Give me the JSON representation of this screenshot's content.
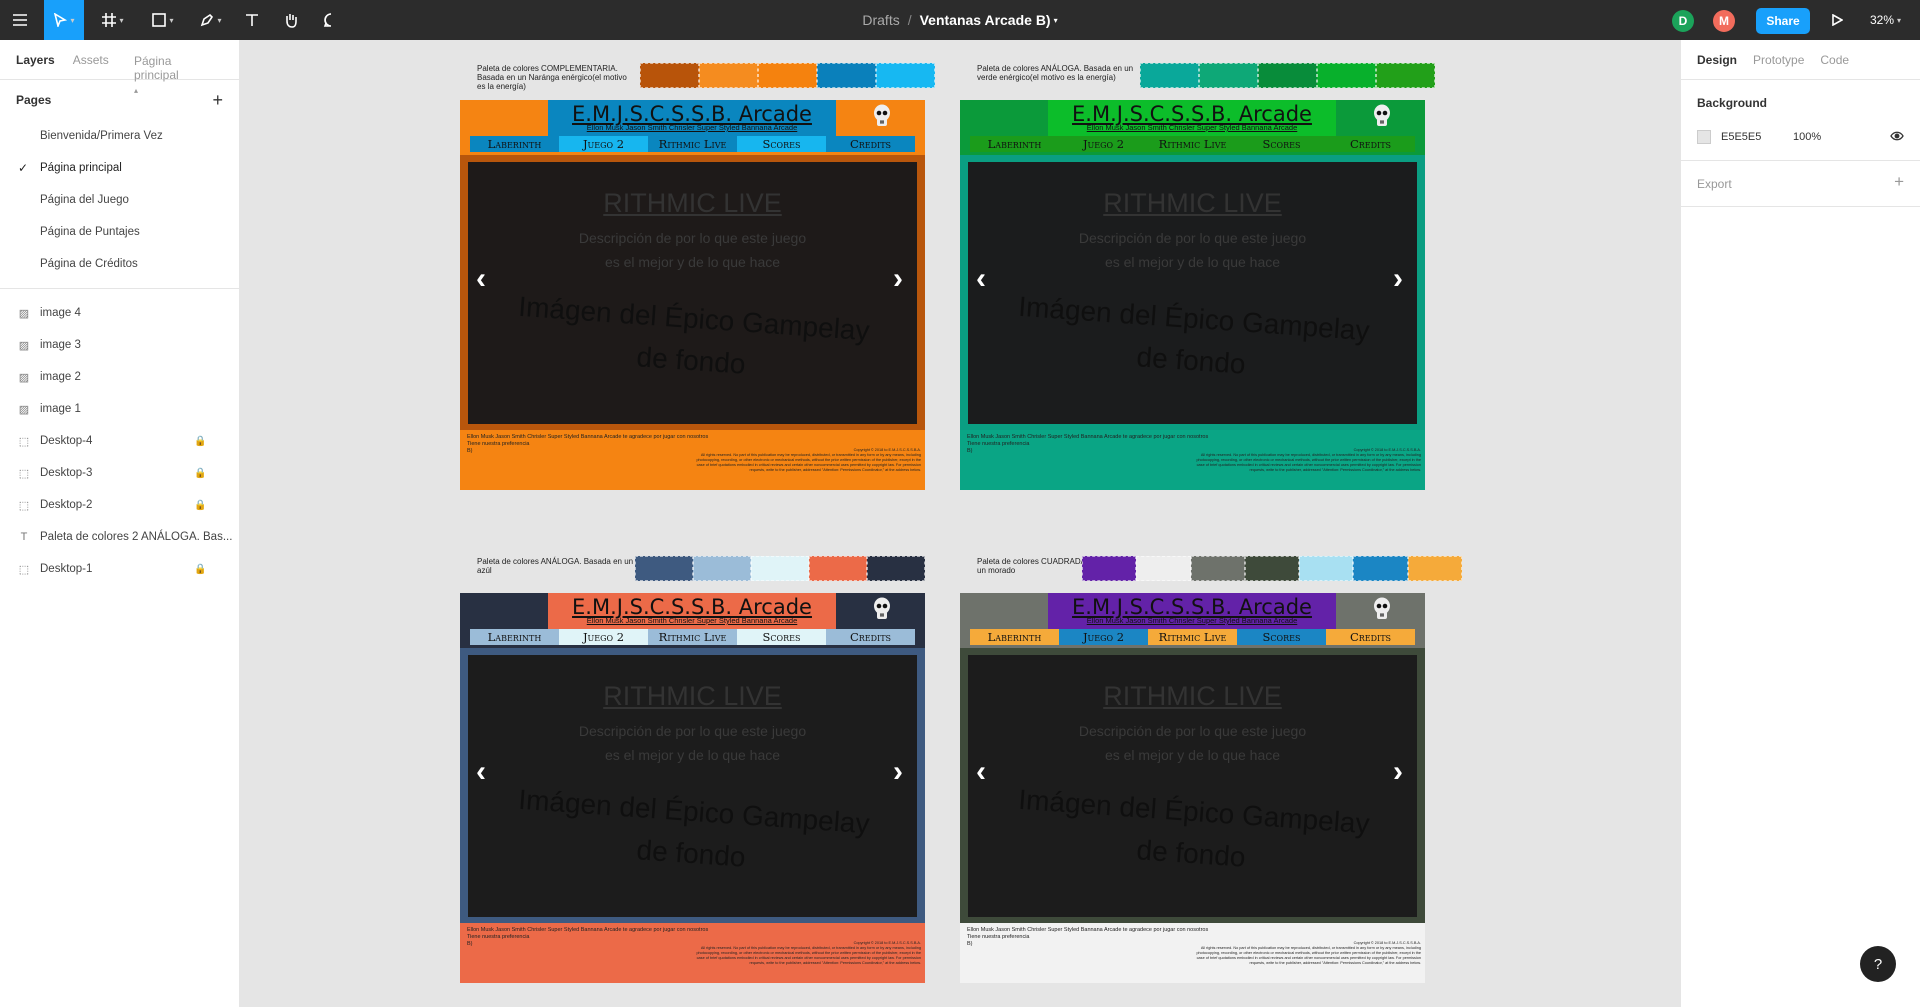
{
  "topbar": {
    "crumb": "Drafts",
    "sep": "/",
    "file_title": "Ventanas Arcade B)",
    "share_label": "Share",
    "zoom": "32%",
    "users": [
      {
        "initial": "D",
        "color": "#1ba35a"
      },
      {
        "initial": "M",
        "color": "#f26c5c"
      }
    ]
  },
  "left": {
    "tabs": [
      "Layers",
      "Assets"
    ],
    "page_selector": "Página principal",
    "pages_header": "Pages",
    "pages": [
      {
        "label": "Bienvenida/Primera Vez",
        "selected": false
      },
      {
        "label": "Página principal",
        "selected": true
      },
      {
        "label": "Página del Juego",
        "selected": false
      },
      {
        "label": "Página de Puntajes",
        "selected": false
      },
      {
        "label": "Página de Créditos",
        "selected": false
      }
    ],
    "layers": [
      {
        "label": "image 4",
        "icon": "image-icon",
        "locked": false
      },
      {
        "label": "image 3",
        "icon": "image-icon",
        "locked": false
      },
      {
        "label": "image 2",
        "icon": "image-icon",
        "locked": false
      },
      {
        "label": "image 1",
        "icon": "image-icon",
        "locked": false
      },
      {
        "label": "Desktop-4",
        "icon": "frame-icon",
        "locked": true
      },
      {
        "label": "Desktop-3",
        "icon": "frame-icon",
        "locked": true
      },
      {
        "label": "Desktop-2",
        "icon": "frame-icon",
        "locked": true
      },
      {
        "label": "Paleta de colores 2 ANÁLOGA. Bas...",
        "icon": "text-icon",
        "locked": false
      },
      {
        "label": "Desktop-1",
        "icon": "frame-icon",
        "locked": true
      }
    ]
  },
  "right": {
    "tabs": [
      "Design",
      "Prototype",
      "Code"
    ],
    "background_label": "Background",
    "bg_hex": "E5E5E5",
    "bg_opacity": "100%",
    "export_label": "Export"
  },
  "frame_text": {
    "title": "E.M.J.S.C.S.S.B. Arcade",
    "subtitle": "Ellon Musk Jason Smith Chrisler Super Styled Bannana Arcade",
    "nav": [
      "Laberinth",
      "Juego 2",
      "Rithmic Live",
      "Scores",
      "Credits"
    ],
    "game_title": "RITHMIC LIVE",
    "game_desc": "Descripción de por lo que este juego es el mejor y de lo que hace",
    "game_image": "Imágen del Épico Gampelay de fondo",
    "footer_thanks": "Ellon Musk Jason Smith Chrisler Super Styled Bannana Arcade te agradece por jugar con nosotros",
    "footer_pref": "Tiene nuestra preferencia",
    "footer_sign": "B)",
    "copyright": "Copyright © 2018 to E.M.J.S.C.S.S.B.A.",
    "legal": "All rights reserved. No part of this publication may be reproduced, distributed, or transmitted in any form or by any means, including photocopying, recording, or other electronic or mechanical methods, without the prior written permission of the publisher, except in the case of brief quotations embodied in critical reviews and certain other noncommercial uses permitted by copyright law. For permission requests, write to the publisher, addressed \"Attention: Permissions Coordinator,\" at the address below."
  },
  "frames": [
    {
      "palette_label": "Paleta de colores COMPLEMENTARIA. Basada en un Naránga enérgico(el motivo es la energía)",
      "swatches": [
        "#b8540a",
        "#f58c1f",
        "#f5820e",
        "#0a80bb",
        "#17b8f2"
      ],
      "header_bg": "#f58412",
      "title_bg": "#0a86bf",
      "frame_border": "#b8560c",
      "footer_bg": "#f58412",
      "nav_bg": [
        "#0a86bf",
        "#17b6ef",
        "#0a86bf",
        "#17b6ef",
        "#0a86bf"
      ],
      "body_bg": "#1e1a19"
    },
    {
      "palette_label": "Paleta de colores ANÁLOGA. Basada en un verde enérgico(el motivo es la energía)",
      "swatches": [
        "#0aa89a",
        "#0ea877",
        "#088c3a",
        "#08b02c",
        "#22a019"
      ],
      "header_bg": "#0b9a3a",
      "title_bg": "#0cbd2a",
      "frame_border": "#0a9e82",
      "footer_bg": "#0aa585",
      "nav_bg": [
        "#1b9c1b",
        "#1b9c1b",
        "#1b9c1b",
        "#1b9c1b",
        "#1b9c1b"
      ],
      "body_bg": "#1b1c1d"
    },
    {
      "palette_label": "Paleta de colores ANÁLOGA. Basada en un azúl",
      "swatches": [
        "#3e5a80",
        "#9bbcd8",
        "#e0f4f8",
        "#ec6a48",
        "#283042"
      ],
      "header_bg": "#283042",
      "title_bg": "#ec6a48",
      "frame_border": "#3e5a80",
      "footer_bg": "#ec6a48",
      "nav_bg": [
        "#9bbcd8",
        "#e0f4f8",
        "#9bbcd8",
        "#e0f4f8",
        "#9bbcd8"
      ],
      "body_bg": "#1c1c1c"
    },
    {
      "palette_label": "Paleta de colores CUADRADA. Basada en un morado",
      "swatches": [
        "#6322a8",
        "#eeeeee",
        "#6e726b",
        "#3e4a3a",
        "#a8e0f2",
        "#1b86c4",
        "#f5aa3a"
      ],
      "header_bg": "#6e726b",
      "title_bg": "#6322a8",
      "frame_border": "#3e4a3a",
      "footer_bg": "#f2f2f2",
      "nav_bg": [
        "#f5aa3a",
        "#1b86c4",
        "#f5aa3a",
        "#1b86c4",
        "#f5aa3a"
      ],
      "body_bg": "#1c1c1c"
    }
  ]
}
